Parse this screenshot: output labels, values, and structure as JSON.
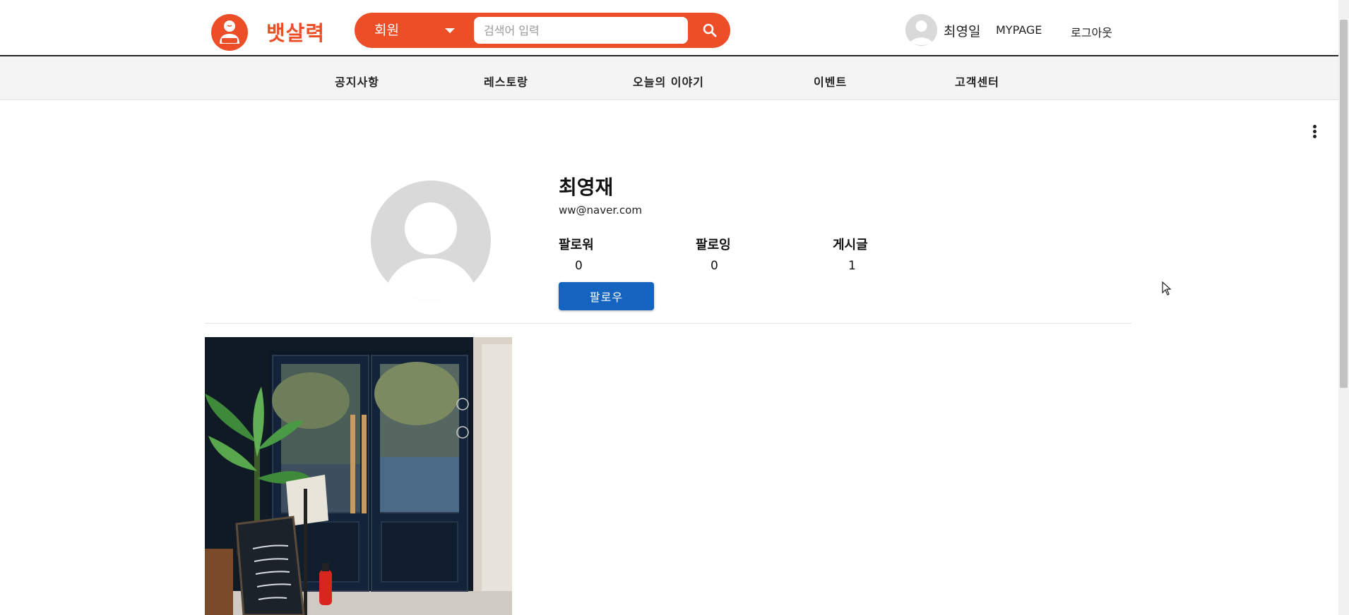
{
  "brand": {
    "name": "뱃살력",
    "color": "#ec4e28"
  },
  "search": {
    "category": "회원",
    "placeholder": "검색어 입력",
    "value": ""
  },
  "user_menu": {
    "name": "최영일",
    "mypage": "MYPAGE",
    "logout": "로그아웃"
  },
  "nav": {
    "items": [
      "공지사항",
      "레스토랑",
      "오늘의 이야기",
      "이벤트",
      "고객센터"
    ]
  },
  "profile": {
    "name": "최영재",
    "email": "ww@naver.com",
    "stats": [
      {
        "label": "팔로워",
        "value": "0"
      },
      {
        "label": "팔로잉",
        "value": "0"
      },
      {
        "label": "게시글",
        "value": "1"
      }
    ],
    "follow_label": "팔로우",
    "follow_color": "#1565c0"
  },
  "posts": [
    {
      "image": "restaurant-entrance-photo"
    }
  ]
}
